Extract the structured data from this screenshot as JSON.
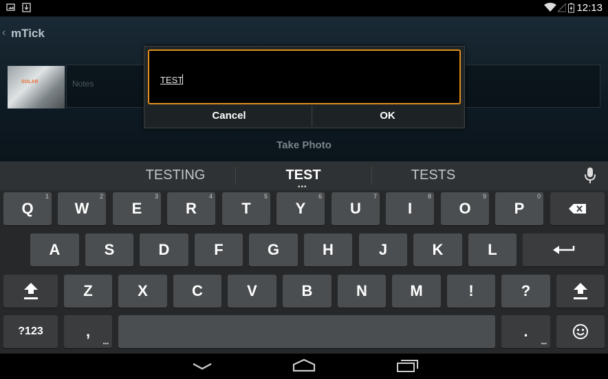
{
  "status_bar": {
    "time": "12:13"
  },
  "app": {
    "title": "mTick",
    "photo_logo": "SOLAR",
    "notes_placeholder": "Notes",
    "take_photo_label": "Take Photo"
  },
  "dialog": {
    "input_value": "TEST",
    "cancel_label": "Cancel",
    "ok_label": "OK"
  },
  "keyboard": {
    "suggestions": [
      "TESTING",
      "TEST",
      "TESTS"
    ],
    "row1": [
      {
        "label": "Q",
        "hint": "1"
      },
      {
        "label": "W",
        "hint": "2"
      },
      {
        "label": "E",
        "hint": "3"
      },
      {
        "label": "R",
        "hint": "4"
      },
      {
        "label": "T",
        "hint": "5"
      },
      {
        "label": "Y",
        "hint": "6"
      },
      {
        "label": "U",
        "hint": "7"
      },
      {
        "label": "I",
        "hint": "8"
      },
      {
        "label": "O",
        "hint": "9"
      },
      {
        "label": "P",
        "hint": "0"
      }
    ],
    "row2": [
      "A",
      "S",
      "D",
      "F",
      "G",
      "H",
      "J",
      "K",
      "L"
    ],
    "row3": [
      "Z",
      "X",
      "C",
      "V",
      "B",
      "N",
      "M",
      "!",
      "?"
    ],
    "symbols_label": "?123",
    "comma_label": ",",
    "period_label": "."
  }
}
